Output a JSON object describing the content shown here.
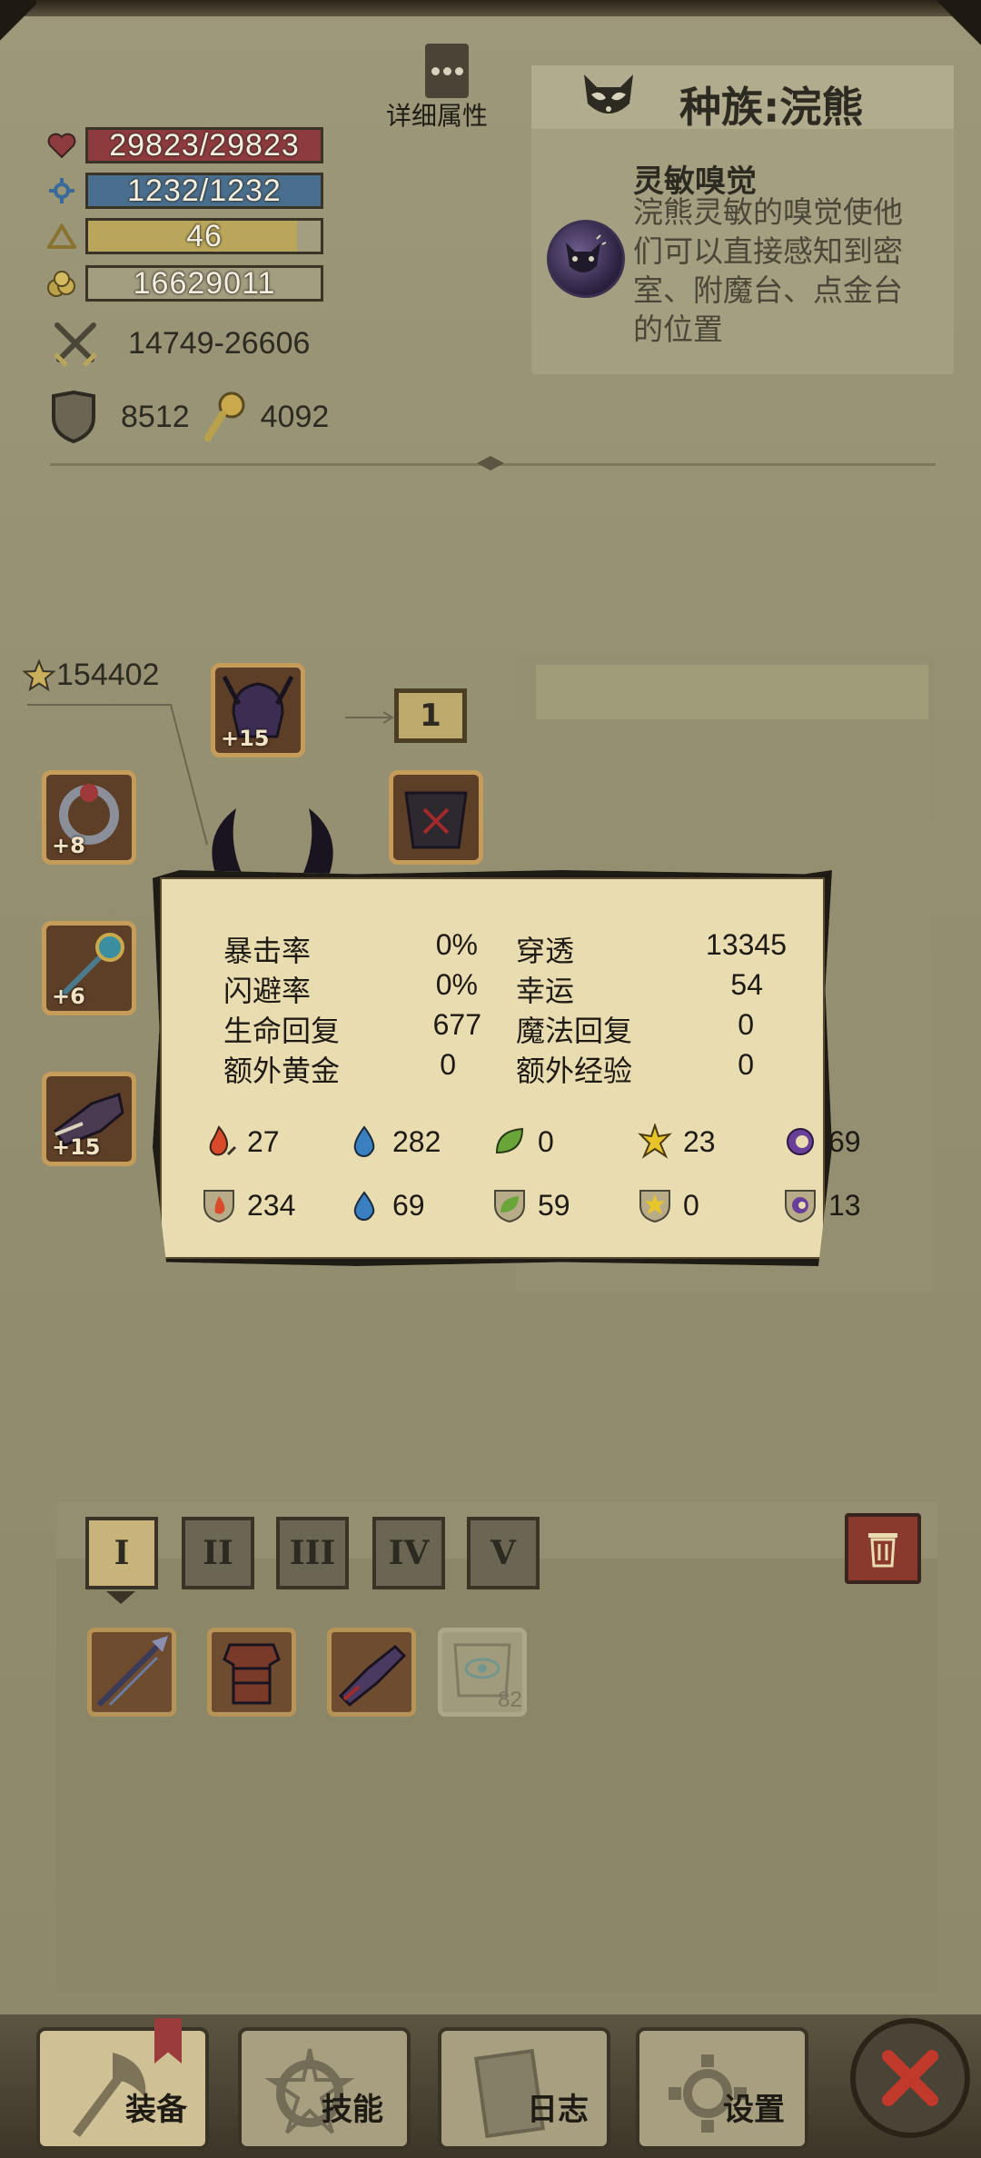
{
  "header": {
    "detail_button_label": "详细属性"
  },
  "stats": {
    "hp": "29823/29823",
    "hp_fraction": 1.0,
    "mp": "1232/1232",
    "mp_fraction": 1.0,
    "level": "46",
    "level_fraction": 0.9,
    "gold": "16629011",
    "attack": "14749-26606",
    "defense": "8512",
    "magic_defense": "4092"
  },
  "race": {
    "title": "种族:浣熊",
    "skill_name": "灵敏嗅觉",
    "skill_desc": "浣熊灵敏的嗅觉使他们可以直接感知到密室、附魔台、点金台的位置"
  },
  "equipment": {
    "power_score": "154402",
    "slot_number": "1",
    "slots": [
      {
        "name": "helmet",
        "plus": "+15"
      },
      {
        "name": "ring",
        "plus": "+8"
      },
      {
        "name": "amulet",
        "plus": "+6"
      },
      {
        "name": "gauntlet",
        "plus": "+15"
      }
    ]
  },
  "detail_popup": {
    "rows": [
      {
        "label_left": "暴击率",
        "val_left": "0%",
        "label_right": "穿透",
        "val_right": "13345"
      },
      {
        "label_left": "闪避率",
        "val_left": "0%",
        "label_right": "幸运",
        "val_right": "54"
      },
      {
        "label_left": "生命回复",
        "val_left": "677",
        "label_right": "魔法回复",
        "val_right": "0"
      },
      {
        "label_left": "额外黄金",
        "val_left": "0",
        "label_right": "额外经验",
        "val_right": "0"
      }
    ],
    "elemental_attack": [
      "27",
      "282",
      "0",
      "23",
      "69"
    ],
    "elemental_resist": [
      "234",
      "69",
      "59",
      "0",
      "13"
    ]
  },
  "loadout": {
    "tabs": [
      "I",
      "II",
      "III",
      "IV",
      "V"
    ],
    "active_tab": 0,
    "ghost_item_count": "82"
  },
  "nav": {
    "equip": "装备",
    "skills": "技能",
    "log": "日志",
    "settings": "设置"
  },
  "colors": {
    "hp": "#8e3b3f",
    "mp": "#4a6f8e",
    "level": "#b9a65a",
    "popup_bg": "#e9dcb1",
    "fire": "#d84a2a",
    "water": "#3a7fc0",
    "nature": "#6aa53a",
    "light": "#e6c42a",
    "dark": "#6a3f9a"
  }
}
